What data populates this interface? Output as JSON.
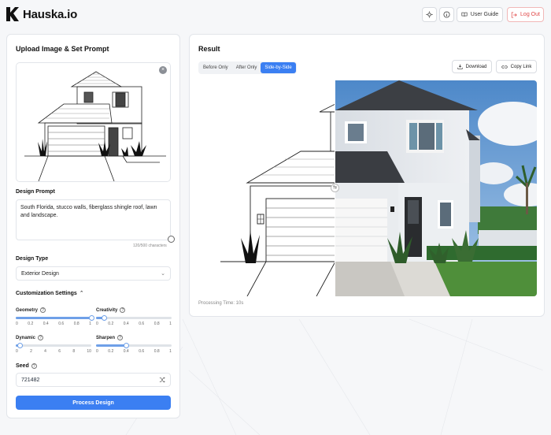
{
  "app": {
    "name": "Hauska.io"
  },
  "header": {
    "user_guide": "User Guide",
    "logout": "Log Out",
    "icons": [
      "settings-icon",
      "info-icon",
      "book-icon",
      "logout-icon"
    ]
  },
  "left_panel": {
    "title": "Upload Image & Set Prompt",
    "design_prompt_label": "Design Prompt",
    "design_prompt_value": "South Florida, stucco walls, fiberglass shingle roof, lawn and landscape.",
    "char_count": "120/500 characters",
    "design_type_label": "Design Type",
    "design_type_value": "Exterior Design",
    "customization_label": "Customization Settings",
    "sliders": [
      {
        "name": "Geometry",
        "value": 1,
        "max": 1,
        "ticks": [
          "0",
          "0.2",
          "0.4",
          "0.6",
          "0.8",
          "1"
        ]
      },
      {
        "name": "Creativity",
        "value": 0.1,
        "max": 1,
        "ticks": [
          "0",
          "0.2",
          "0.4",
          "0.6",
          "0.8",
          "1"
        ]
      },
      {
        "name": "Dynamic",
        "value": 0.5,
        "max": 10,
        "ticks": [
          "0",
          "2",
          "4",
          "6",
          "8",
          "10"
        ]
      },
      {
        "name": "Sharpen",
        "value": 0.4,
        "max": 1,
        "ticks": [
          "0",
          "0.2",
          "0.4",
          "0.6",
          "0.8",
          "1"
        ]
      }
    ],
    "seed_label": "Seed",
    "seed_value": "721482",
    "process_button": "Process Design"
  },
  "right_panel": {
    "title": "Result",
    "tabs": [
      "Before Only",
      "After Only",
      "Side-by-Side"
    ],
    "active_tab": "Side-by-Side",
    "download": "Download",
    "copy_link": "Copy Link",
    "processing_time": "Processing Time: 10s"
  },
  "colors": {
    "accent": "#3b7ff2",
    "logout": "#e04848"
  }
}
